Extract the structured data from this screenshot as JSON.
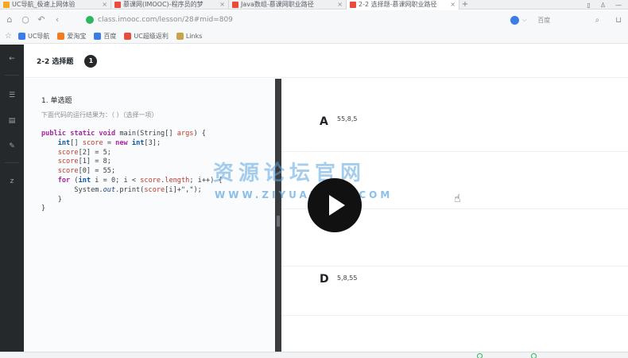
{
  "browser": {
    "tabs": [
      {
        "label": "UC导航_极速上网体验",
        "icon_color": "#f5a623"
      },
      {
        "label": "慕课网(IMOOC)-程序员的梦",
        "icon_color": "#e74c3c"
      },
      {
        "label": "Java数组-慕课网职业路径",
        "icon_color": "#e74c3c"
      },
      {
        "label": "2-2 选择题-慕课网职业路径",
        "icon_color": "#e74c3c"
      }
    ],
    "tab_close": "×",
    "new_tab": "+",
    "url": "class.imooc.com/lesson/28#mid=809",
    "search_engine": "百度",
    "bookmarks": [
      {
        "label": "UC导航",
        "icon_color": "#3b7ce6"
      },
      {
        "label": "爱淘宝",
        "icon_color": "#f47a20"
      },
      {
        "label": "百度",
        "icon_color": "#3b7ce6"
      },
      {
        "label": "UC超级返利",
        "icon_color": "#e74c3c"
      },
      {
        "label": "Links",
        "icon_color": "#c9a24a"
      }
    ]
  },
  "question": {
    "title": "2-2 选择题",
    "badge": "1",
    "type_label": "1. 单选题",
    "prompt": "下面代码的运行结果为：（ ）（选择一项）"
  },
  "options": [
    {
      "letter": "A",
      "text": "55,8,5"
    },
    {
      "letter": "",
      "text": ""
    },
    {
      "letter": "",
      "text": ""
    },
    {
      "letter": "D",
      "text": "5,8,55"
    }
  ],
  "watermark": {
    "main": "资源论坛官网",
    "sub": "WWW.ZIYUANBBS.COM"
  },
  "colors": {
    "sidebar": "#26292c",
    "splitter": "#3a3d40",
    "accent_green": "#2fb55d"
  }
}
